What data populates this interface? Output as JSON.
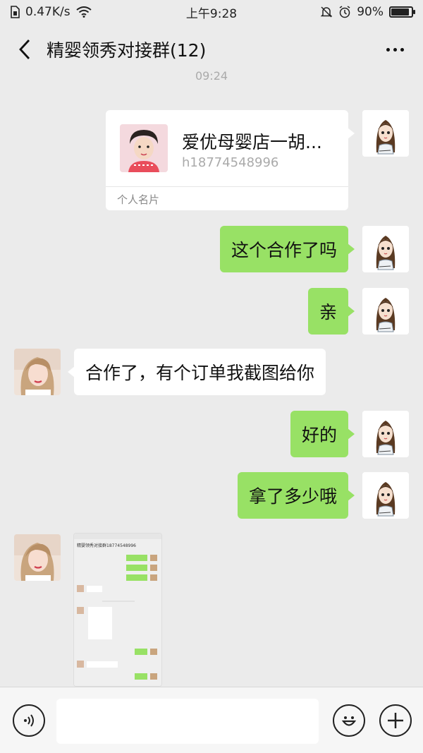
{
  "status_bar": {
    "network_speed": "0.47K/s",
    "time": "上午9:28",
    "battery_percent": "90%",
    "battery_level": 0.9
  },
  "nav": {
    "title": "精婴领秀对接群(12)"
  },
  "chat": {
    "timestamp": "09:24",
    "contact_card": {
      "name": "爱优母婴店一胡...",
      "phone": "h18774548996",
      "label": "个人名片"
    },
    "messages": [
      {
        "side": "mine",
        "text": "这个合作了吗"
      },
      {
        "side": "mine",
        "text": "亲"
      },
      {
        "side": "other",
        "text": "合作了，有个订单我截图给你"
      },
      {
        "side": "mine",
        "text": "好的"
      },
      {
        "side": "mine",
        "text": "拿了多少哦"
      }
    ],
    "screenshot_title": "精婴领秀对接群18774548996"
  },
  "icons": {
    "back": "chevron-left-icon",
    "more": "more-dots-icon",
    "voice": "voice-icon",
    "emoji": "emoji-icon",
    "add": "plus-icon"
  },
  "colors": {
    "my_bubble": "#98e165",
    "other_bubble": "#ffffff",
    "background": "#ebebeb"
  }
}
